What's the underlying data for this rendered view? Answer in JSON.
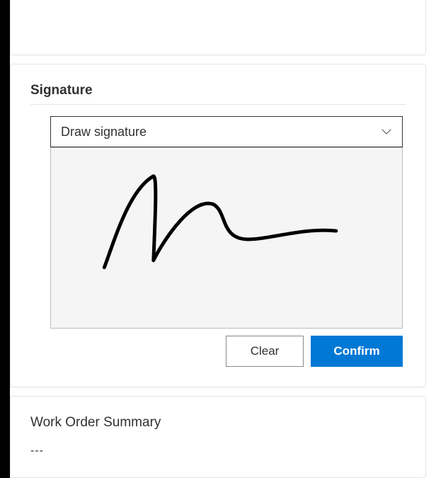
{
  "signature": {
    "title": "Signature",
    "dropdown_label": "Draw signature",
    "clear_label": "Clear",
    "confirm_label": "Confirm"
  },
  "summary": {
    "title": "Work Order Summary",
    "placeholder": "---"
  },
  "colors": {
    "primary": "#0078d4"
  }
}
